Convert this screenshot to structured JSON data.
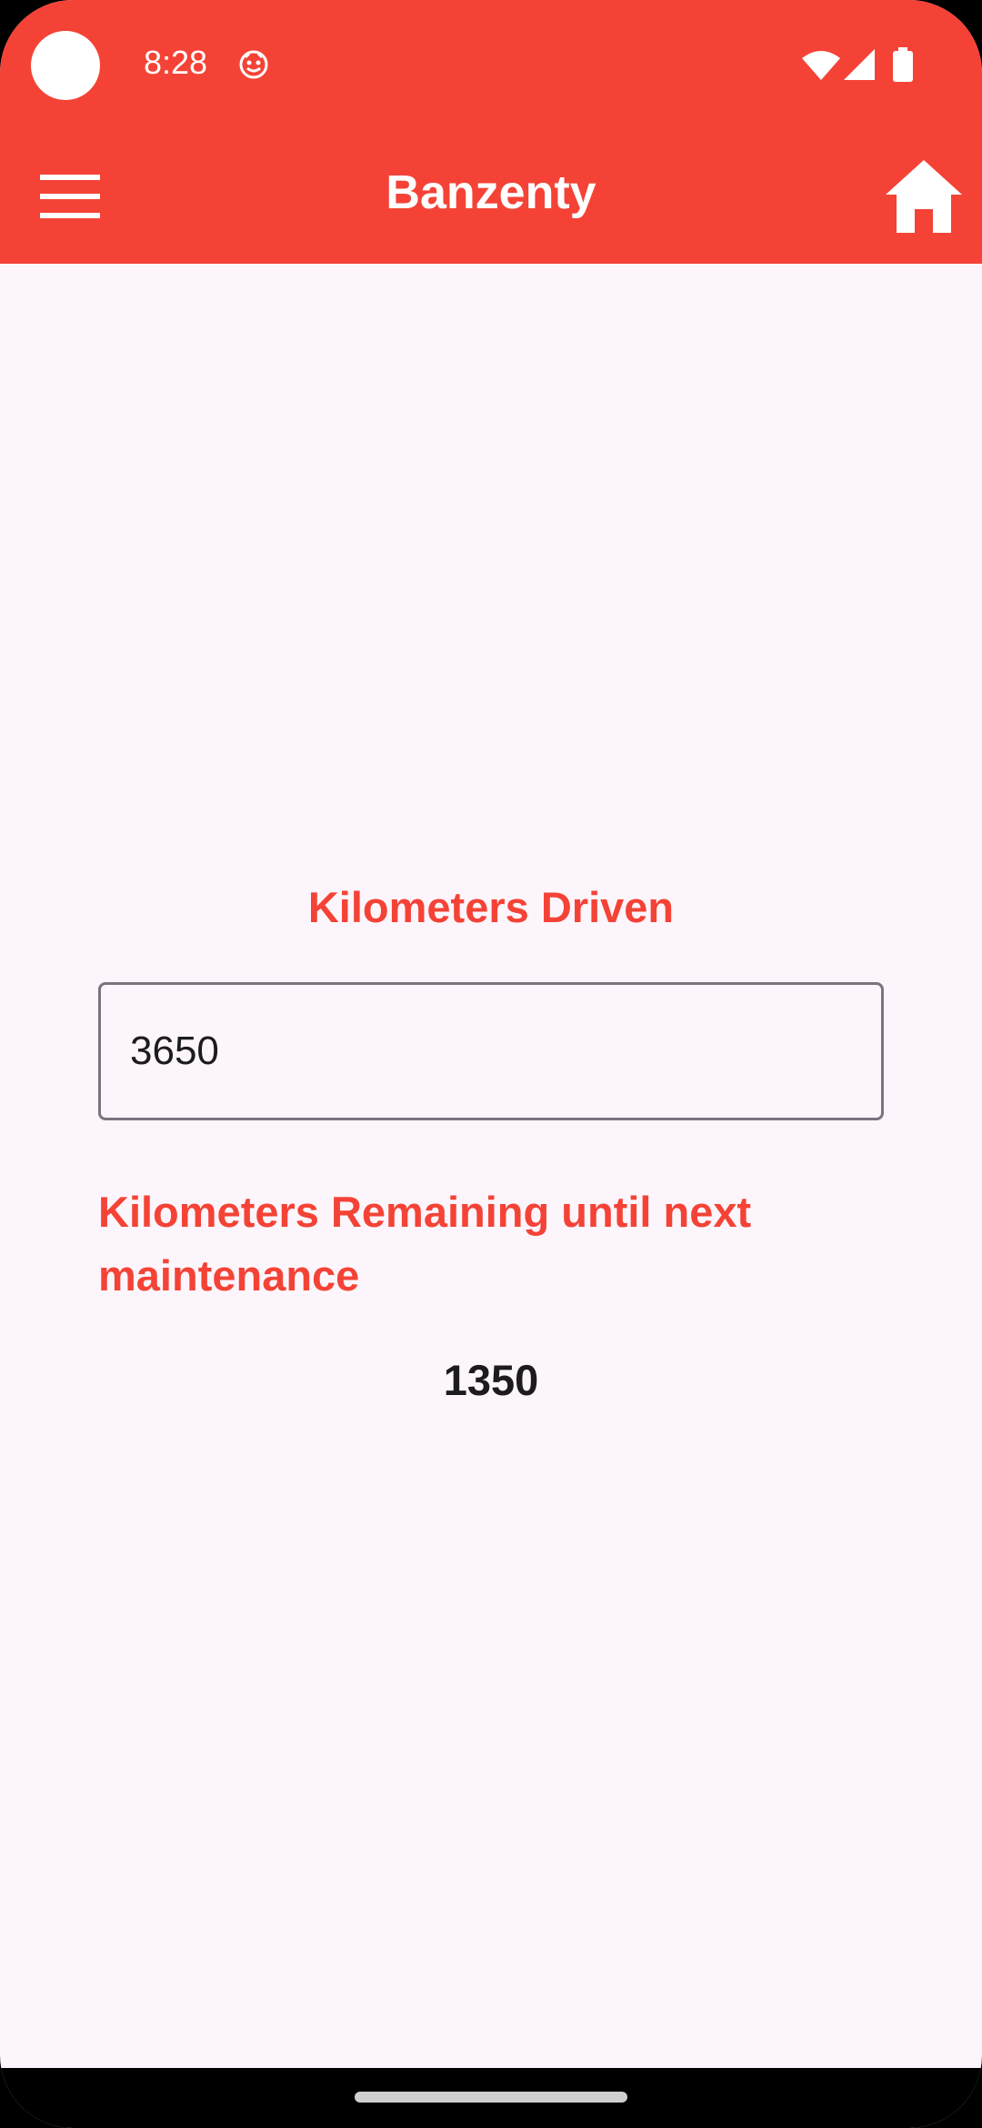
{
  "status_bar": {
    "time": "8:28",
    "icons": [
      "camera-dot",
      "notification-icon",
      "wifi-icon",
      "signal-icon",
      "battery-icon"
    ]
  },
  "app_bar": {
    "title": "Banzenty",
    "menu_icon": "hamburger-menu-icon",
    "home_icon": "home-icon"
  },
  "form": {
    "km_driven_label": "Kilometers Driven",
    "km_driven_value": "3650",
    "km_remaining_label": "Kilometers Remaining until next maintenance",
    "km_remaining_value": "1350"
  },
  "colors": {
    "primary": "#f44336",
    "background": "#fcf5fc",
    "text_dark": "#1d1b20",
    "input_border": "#79747e"
  }
}
